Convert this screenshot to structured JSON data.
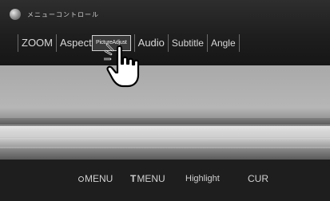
{
  "header": {
    "title": "メニューコントロール"
  },
  "menu": {
    "items": [
      {
        "label": "ZOOM"
      },
      {
        "label": "Aspect"
      },
      {
        "label": "PictureAdjust"
      },
      {
        "label": "Audio"
      },
      {
        "label": "Subtitle"
      },
      {
        "label": "Angle"
      }
    ]
  },
  "bottom_bar": {
    "menu_label": "MENU",
    "tmenu_label": "MENU",
    "tmenu_prefix": "T",
    "highlight_label": "Highlight",
    "cur_label": "CUR"
  },
  "icons": {
    "app": "disc-icon",
    "cursor": "hand-pointer-icon",
    "menu_button": "circle-icon"
  },
  "colors": {
    "background": "#1e1e1e",
    "text": "#d8d8d8",
    "selected_border": "#d0d0d0"
  }
}
